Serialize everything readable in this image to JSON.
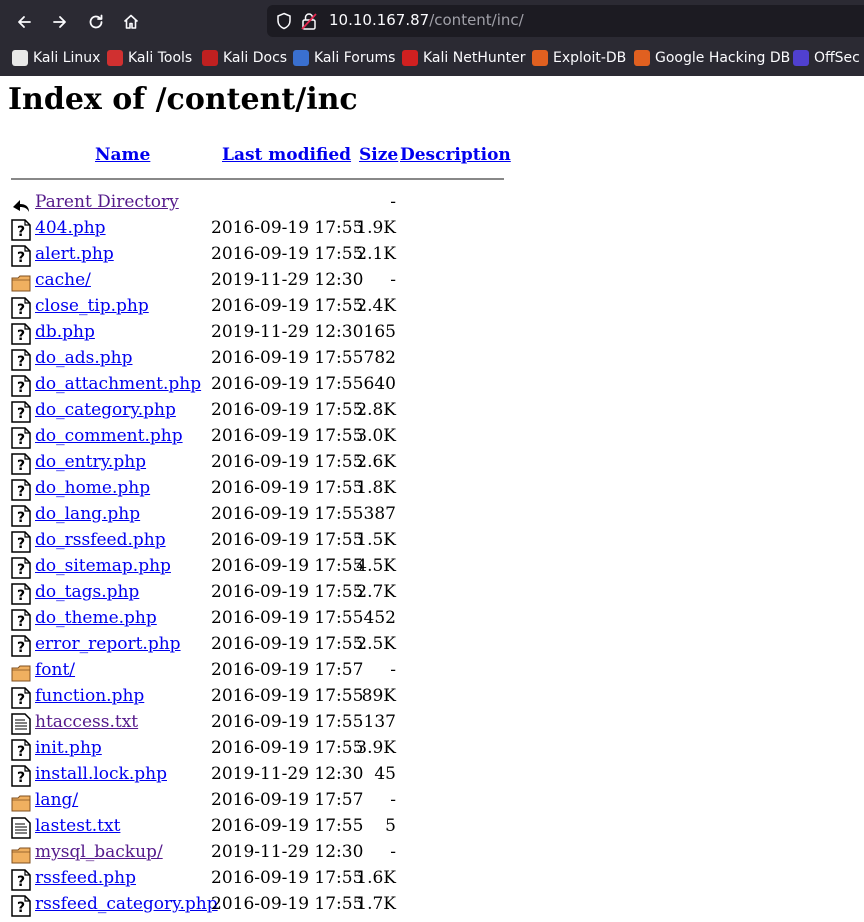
{
  "browser": {
    "url_host": "10.10.167.87",
    "url_path": "/content/inc/",
    "bookmarks": [
      {
        "label": "Kali Linux",
        "color": "#e8e8e8"
      },
      {
        "label": "Kali Tools",
        "color": "#d03030"
      },
      {
        "label": "Kali Docs",
        "color": "#c02020"
      },
      {
        "label": "Kali Forums",
        "color": "#3a70d0"
      },
      {
        "label": "Kali NetHunter",
        "color": "#d02020"
      },
      {
        "label": "Exploit-DB",
        "color": "#e06020"
      },
      {
        "label": "Google Hacking DB",
        "color": "#e06020"
      },
      {
        "label": "OffSec",
        "color": "#5040d0"
      }
    ]
  },
  "page": {
    "title": "Index of /content/inc",
    "columns": {
      "name": "Name",
      "modified": "Last modified",
      "size": "Size",
      "description": "Description"
    },
    "entries": [
      {
        "name": "Parent Directory",
        "date": "",
        "size": "-",
        "type": "parent",
        "visited": true
      },
      {
        "name": "404.php",
        "date": "2016-09-19 17:55",
        "size": "1.9K",
        "type": "unknown",
        "visited": false
      },
      {
        "name": "alert.php",
        "date": "2016-09-19 17:55",
        "size": "2.1K",
        "type": "unknown",
        "visited": false
      },
      {
        "name": "cache/",
        "date": "2019-11-29 12:30",
        "size": "-",
        "type": "folder",
        "visited": false
      },
      {
        "name": "close_tip.php",
        "date": "2016-09-19 17:55",
        "size": "2.4K",
        "type": "unknown",
        "visited": false
      },
      {
        "name": "db.php",
        "date": "2019-11-29 12:30",
        "size": "165",
        "type": "unknown",
        "visited": false
      },
      {
        "name": "do_ads.php",
        "date": "2016-09-19 17:55",
        "size": "782",
        "type": "unknown",
        "visited": false
      },
      {
        "name": "do_attachment.php",
        "date": "2016-09-19 17:55",
        "size": "640",
        "type": "unknown",
        "visited": false
      },
      {
        "name": "do_category.php",
        "date": "2016-09-19 17:55",
        "size": "2.8K",
        "type": "unknown",
        "visited": false
      },
      {
        "name": "do_comment.php",
        "date": "2016-09-19 17:55",
        "size": "3.0K",
        "type": "unknown",
        "visited": false
      },
      {
        "name": "do_entry.php",
        "date": "2016-09-19 17:55",
        "size": "2.6K",
        "type": "unknown",
        "visited": false
      },
      {
        "name": "do_home.php",
        "date": "2016-09-19 17:55",
        "size": "1.8K",
        "type": "unknown",
        "visited": false
      },
      {
        "name": "do_lang.php",
        "date": "2016-09-19 17:55",
        "size": "387",
        "type": "unknown",
        "visited": false
      },
      {
        "name": "do_rssfeed.php",
        "date": "2016-09-19 17:55",
        "size": "1.5K",
        "type": "unknown",
        "visited": false
      },
      {
        "name": "do_sitemap.php",
        "date": "2016-09-19 17:55",
        "size": "4.5K",
        "type": "unknown",
        "visited": false
      },
      {
        "name": "do_tags.php",
        "date": "2016-09-19 17:55",
        "size": "2.7K",
        "type": "unknown",
        "visited": false
      },
      {
        "name": "do_theme.php",
        "date": "2016-09-19 17:55",
        "size": "452",
        "type": "unknown",
        "visited": false
      },
      {
        "name": "error_report.php",
        "date": "2016-09-19 17:55",
        "size": "2.5K",
        "type": "unknown",
        "visited": false
      },
      {
        "name": "font/",
        "date": "2016-09-19 17:57",
        "size": "-",
        "type": "folder",
        "visited": false
      },
      {
        "name": "function.php",
        "date": "2016-09-19 17:55",
        "size": "89K",
        "type": "unknown",
        "visited": false
      },
      {
        "name": "htaccess.txt",
        "date": "2016-09-19 17:55",
        "size": "137",
        "type": "text",
        "visited": true
      },
      {
        "name": "init.php",
        "date": "2016-09-19 17:55",
        "size": "3.9K",
        "type": "unknown",
        "visited": false
      },
      {
        "name": "install.lock.php",
        "date": "2019-11-29 12:30",
        "size": "45",
        "type": "unknown",
        "visited": false
      },
      {
        "name": "lang/",
        "date": "2016-09-19 17:57",
        "size": "-",
        "type": "folder",
        "visited": false
      },
      {
        "name": "lastest.txt",
        "date": "2016-09-19 17:55",
        "size": "5",
        "type": "text",
        "visited": false
      },
      {
        "name": "mysql_backup/",
        "date": "2019-11-29 12:30",
        "size": "-",
        "type": "folder",
        "visited": true
      },
      {
        "name": "rssfeed.php",
        "date": "2016-09-19 17:55",
        "size": "1.6K",
        "type": "unknown",
        "visited": false
      },
      {
        "name": "rssfeed_category.php",
        "date": "2016-09-19 17:55",
        "size": "1.7K",
        "type": "unknown",
        "visited": false
      }
    ]
  }
}
